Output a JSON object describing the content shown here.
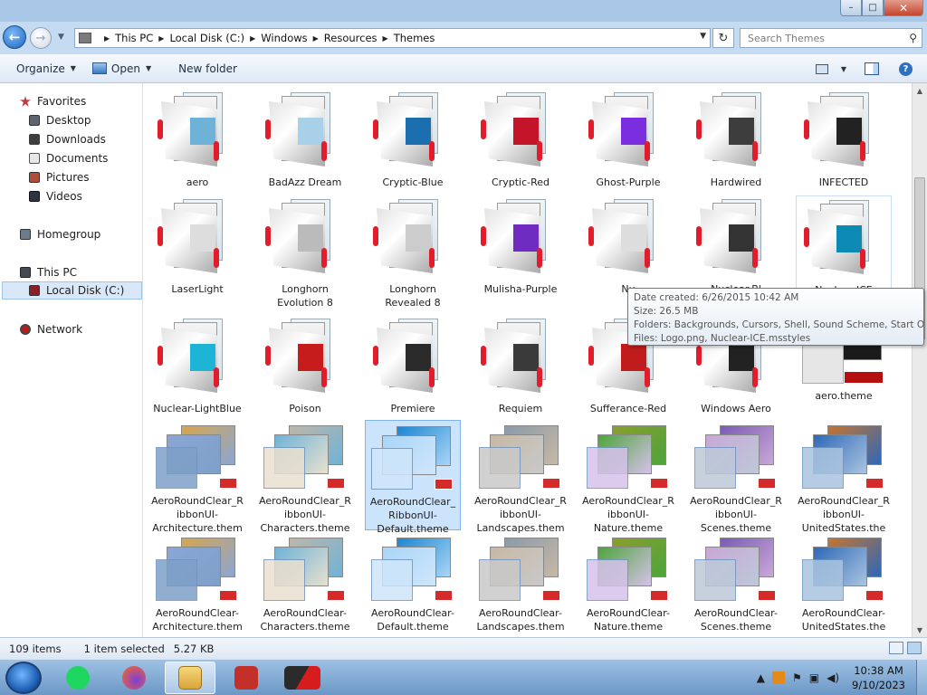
{
  "window": {
    "controls": {
      "minimize": "–",
      "maximize": "□",
      "close": "✕"
    }
  },
  "address": {
    "breadcrumbs": [
      "This PC",
      "Local Disk (C:)",
      "Windows",
      "Resources",
      "Themes"
    ],
    "search_placeholder": "Search Themes"
  },
  "toolbar": {
    "organize": "Organize",
    "open": "Open",
    "new_folder": "New folder"
  },
  "nav": {
    "favorites": "Favorites",
    "desktop": "Desktop",
    "downloads": "Downloads",
    "documents": "Documents",
    "pictures": "Pictures",
    "videos": "Videos",
    "homegroup": "Homegroup",
    "this_pc": "This PC",
    "local_disk": "Local Disk (C:)",
    "network": "Network"
  },
  "row1": [
    "aero",
    "BadAzz Dream",
    "Cryptic-Blue",
    "Cryptic-Red",
    "Ghost-Purple",
    "Hardwired",
    "INFECTED"
  ],
  "row2": [
    "LaserLight",
    "Longhorn Evolution 8",
    "Longhorn Revealed 8",
    "Mulisha-Purple",
    "Nu",
    "Nuclear-Bl",
    "Nuclear-ICE"
  ],
  "row3": [
    "Nuclear-LightBlue",
    "Poison",
    "Premiere",
    "Requiem",
    "Sufferance-Red",
    "Windows Aero",
    "aero.theme"
  ],
  "row4": [
    "AeroRoundClear_RibbonUI-Architecture.theme",
    "AeroRoundClear_RibbonUI-Characters.theme",
    "AeroRoundClear_RibbonUI-Default.theme",
    "AeroRoundClear_RibbonUI-Landscapes.theme",
    "AeroRoundClear_RibbonUI-Nature.theme",
    "AeroRoundClear_RibbonUI-Scenes.theme",
    "AeroRoundClear_RibbonUI-UnitedStates.theme"
  ],
  "row5": [
    "AeroRoundClear-Architecture.theme",
    "AeroRoundClear-Characters.theme",
    "AeroRoundClear-Default.theme",
    "AeroRoundClear-Landscapes.theme",
    "AeroRoundClear-Nature.theme",
    "AeroRoundClear-Scenes.theme",
    "AeroRoundClear-UnitedStates.theme"
  ],
  "tooltip": {
    "date_created": "Date created: 6/26/2015 10:42 AM",
    "size": "Size: 26.5 MB",
    "folders": "Folders: Backgrounds, Cursors, Shell, Sound Scheme, Start Orb",
    "files": "Files: Logo.png, Nuclear-ICE.msstyles"
  },
  "status": {
    "items": "109 items",
    "selected": "1 item selected",
    "size": "5.27 KB"
  },
  "taskbar": {
    "time": "10:38 AM",
    "date": "9/10/2023"
  },
  "colors": {
    "accent": "#1d64c2",
    "selection": "#cce4fb",
    "glow": "#e11d2c"
  },
  "icons": [
    "back-arrow-icon",
    "forward-arrow-icon",
    "refresh-icon",
    "search-icon",
    "help-icon",
    "star-icon",
    "folder-icon",
    "network-icon"
  ]
}
